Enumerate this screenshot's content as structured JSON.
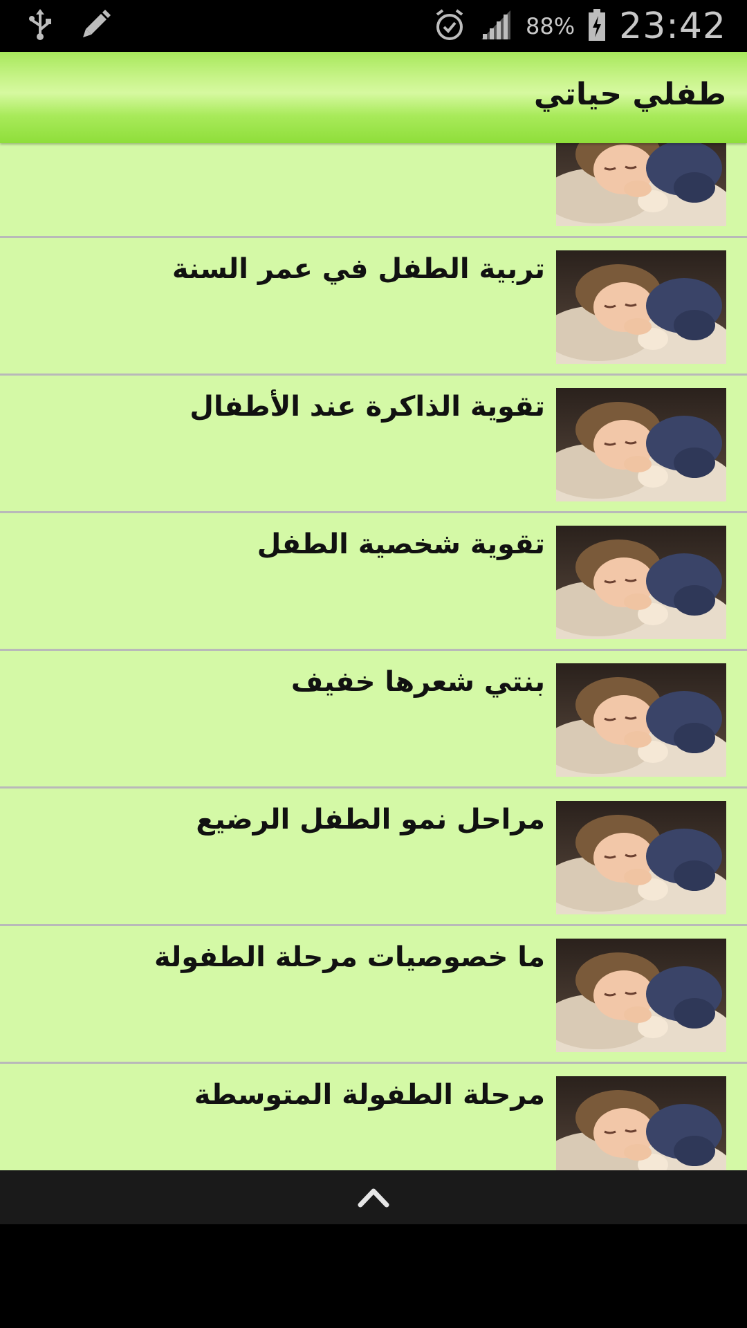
{
  "status_bar": {
    "time": "23:42",
    "battery_percent": "88%",
    "icons": [
      "usb-icon",
      "pencil-icon",
      "alarm-icon",
      "signal-icon",
      "battery-charging-icon"
    ]
  },
  "app_bar": {
    "title": "طفلي حياتي"
  },
  "list": {
    "items": [
      {
        "title": ""
      },
      {
        "title": "تربية الطفل في عمر السنة"
      },
      {
        "title": "تقوية الذاكرة عند الأطفال"
      },
      {
        "title": "تقوية شخصية الطفل"
      },
      {
        "title": "بنتي شعرها خفيف"
      },
      {
        "title": "مراحل نمو الطفل الرضيع"
      },
      {
        "title": "ما خصوصيات مرحلة الطفولة"
      },
      {
        "title": "مرحلة الطفولة المتوسطة"
      },
      {
        "title": ""
      }
    ]
  },
  "nav": {
    "icon": "chevron-up-icon"
  }
}
